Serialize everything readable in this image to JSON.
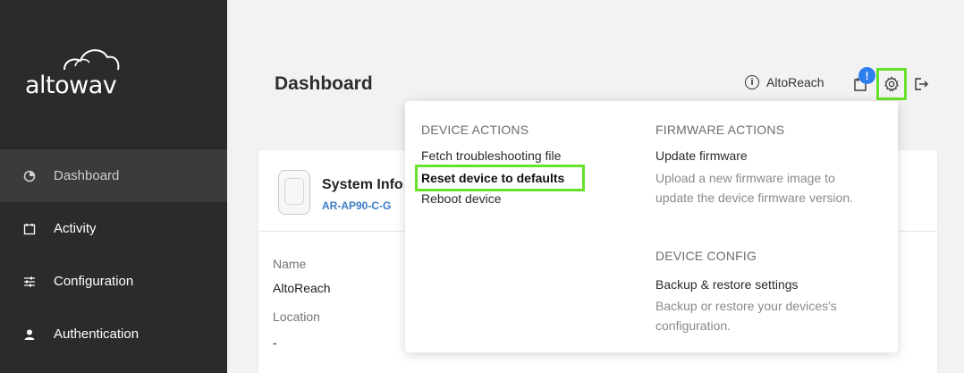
{
  "brand": {
    "logo_text": "altowav"
  },
  "sidebar": {
    "items": [
      {
        "label": "Dashboard",
        "icon": "pie-chart-icon",
        "active": true
      },
      {
        "label": "Activity",
        "icon": "calendar-icon",
        "active": false
      },
      {
        "label": "Configuration",
        "icon": "sliders-icon",
        "active": false
      },
      {
        "label": "Authentication",
        "icon": "user-icon",
        "active": false
      }
    ]
  },
  "header": {
    "title": "Dashboard",
    "device_name": "AltoReach",
    "notification_badge": "!"
  },
  "card": {
    "title": "System Info",
    "model": "AR-AP90-C-G",
    "fields": [
      {
        "label": "Name",
        "value": "AltoReach"
      },
      {
        "label": "Location",
        "value": "-"
      }
    ]
  },
  "menu": {
    "device_actions": {
      "title": "DEVICE ACTIONS",
      "items": [
        "Fetch troubleshooting file",
        "Reset device to defaults",
        "Reboot device"
      ]
    },
    "firmware_actions": {
      "title": "FIRMWARE ACTIONS",
      "item": "Update firmware",
      "description": "Upload a new firmware image to update the device firmware version."
    },
    "device_config": {
      "title": "DEVICE CONFIG",
      "item": "Backup & restore settings",
      "description": "Backup or restore your devices's configuration."
    }
  },
  "colors": {
    "highlight": "#67e22b",
    "sidebar_bg": "#2b2b2b",
    "accent_blue": "#2d7ff0",
    "model_blue": "#3b7cc4"
  }
}
